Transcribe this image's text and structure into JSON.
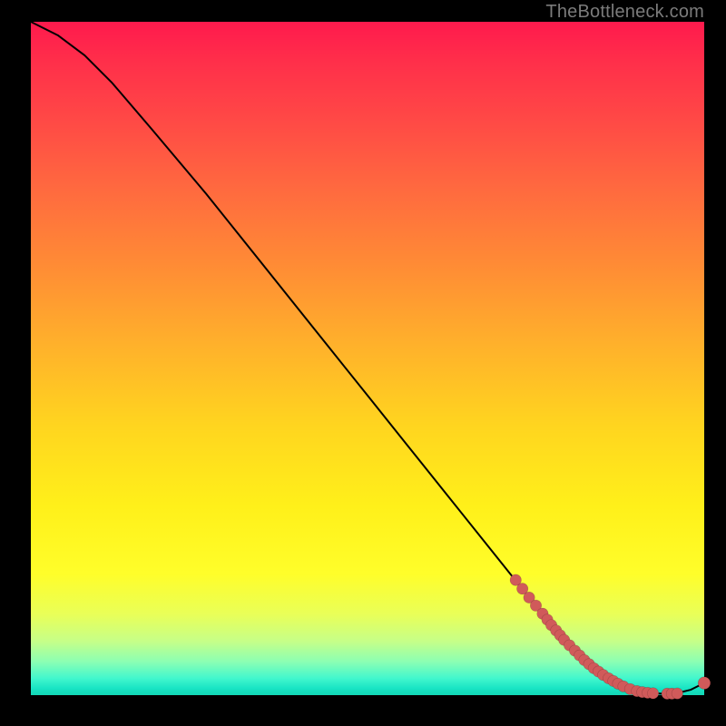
{
  "attribution": "TheBottleneck.com",
  "chart_data": {
    "type": "line",
    "title": "",
    "xlabel": "",
    "ylabel": "",
    "xlim": [
      0,
      100
    ],
    "ylim": [
      0,
      100
    ],
    "curve": {
      "x": [
        0,
        4,
        8,
        12,
        18,
        26,
        34,
        42,
        50,
        56,
        62,
        68,
        74,
        78,
        82,
        86,
        88,
        90,
        92,
        94,
        96,
        98,
        100
      ],
      "y": [
        100,
        98,
        95,
        91,
        84,
        74.5,
        64.5,
        54.5,
        44.5,
        37,
        29.5,
        22,
        14.5,
        9.5,
        5.3,
        2.2,
        1.2,
        0.6,
        0.3,
        0.2,
        0.3,
        0.8,
        1.8
      ]
    },
    "series": [
      {
        "name": "markers",
        "x": [
          72,
          73,
          74,
          75,
          76,
          76.7,
          77.3,
          78,
          78.6,
          79.2,
          80,
          80.8,
          81.5,
          82.2,
          82.9,
          83.6,
          84.3,
          85,
          85.8,
          86.5,
          87.2,
          88,
          89,
          90,
          90.8,
          91.6,
          92.4,
          94.5,
          95.2,
          96,
          100
        ],
        "y": [
          17.1,
          15.8,
          14.5,
          13.3,
          12.1,
          11.2,
          10.4,
          9.6,
          8.9,
          8.2,
          7.4,
          6.6,
          5.9,
          5.2,
          4.6,
          4.0,
          3.5,
          3.0,
          2.5,
          2.1,
          1.7,
          1.3,
          0.9,
          0.6,
          0.45,
          0.35,
          0.28,
          0.22,
          0.22,
          0.25,
          1.8
        ]
      }
    ],
    "gradient_stops": [
      {
        "pos": 0,
        "color": "#ff1a4d"
      },
      {
        "pos": 0.5,
        "color": "#ffd51f"
      },
      {
        "pos": 0.82,
        "color": "#fffe2a"
      },
      {
        "pos": 1.0,
        "color": "#13d7b6"
      }
    ]
  }
}
